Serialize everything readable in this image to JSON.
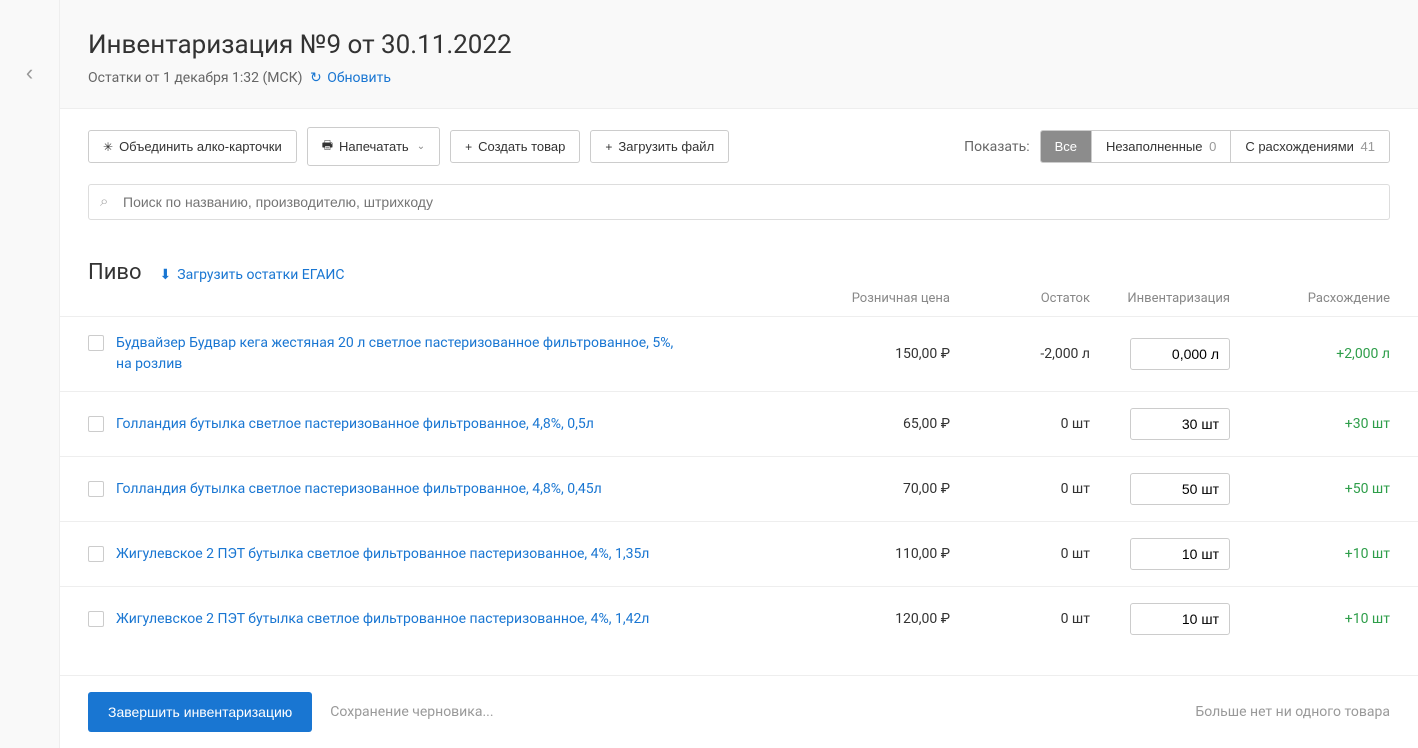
{
  "header": {
    "title": "Инвентаризация №9 от 30.11.2022",
    "subline": "Остатки от 1 декабря 1:32 (МСК)",
    "refresh_label": "Обновить"
  },
  "toolbar": {
    "merge_label": "Объединить алко-карточки",
    "print_label": "Напечатать",
    "create_label": "Создать товар",
    "upload_label": "Загрузить файл"
  },
  "filters": {
    "show_label": "Показать:",
    "all_label": "Все",
    "unfilled_label": "Незаполненные",
    "unfilled_count": "0",
    "discrep_label": "С расхождениями",
    "discrep_count": "41"
  },
  "search": {
    "placeholder": "Поиск по названию, производителю, штрихкоду"
  },
  "section": {
    "title": "Пиво",
    "egais_label": "Загрузить остатки ЕГАИС"
  },
  "cols": {
    "price": "Розничная цена",
    "stock": "Остаток",
    "inventory": "Инвентаризация",
    "diff": "Расхождение"
  },
  "rows": [
    {
      "name": "Будвайзер Будвар кега жестяная 20 л светлое пастеризованное фильтрованное, 5%, на розлив",
      "price": "150,00",
      "stock": "-2,000 л",
      "inventory": "0,000 л",
      "diff": "+2,000 л"
    },
    {
      "name": "Голландия бутылка светлое пастеризованное фильтрованное, 4,8%, 0,5л",
      "price": "65,00",
      "stock": "0 шт",
      "inventory": "30 шт",
      "diff": "+30 шт"
    },
    {
      "name": "Голландия бутылка светлое пастеризованное фильтрованное, 4,8%, 0,45л",
      "price": "70,00",
      "stock": "0 шт",
      "inventory": "50 шт",
      "diff": "+50 шт"
    },
    {
      "name": "Жигулевское 2 ПЭТ бутылка светлое фильтрованное пастеризованное, 4%, 1,35л",
      "price": "110,00",
      "stock": "0 шт",
      "inventory": "10 шт",
      "diff": "+10 шт"
    },
    {
      "name": "Жигулевское 2 ПЭТ бутылка светлое фильтрованное пастеризованное, 4%, 1,42л",
      "price": "120,00",
      "stock": "0 шт",
      "inventory": "10 шт",
      "diff": "+10 шт"
    }
  ],
  "footer": {
    "submit_label": "Завершить инвентаризацию",
    "save_hint": "Сохранение черновика...",
    "empty_hint": "Больше нет ни одного товара"
  }
}
